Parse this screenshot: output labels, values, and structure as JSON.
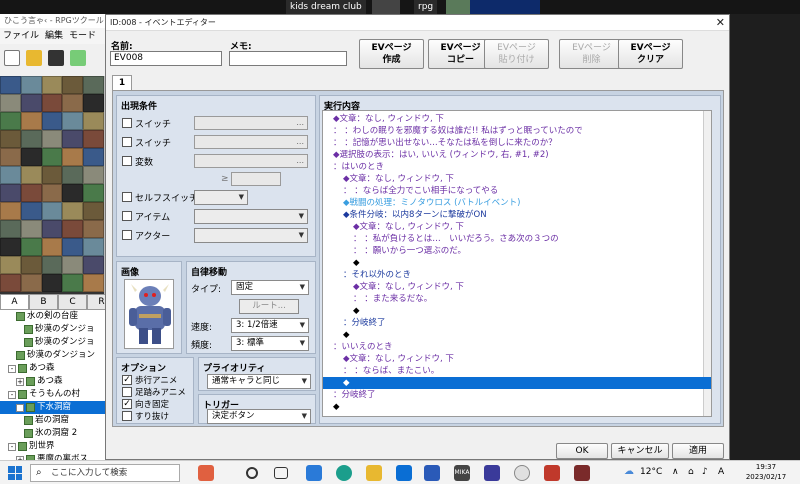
{
  "top_strip": {
    "app1": "kids dream club",
    "app2": "rpg"
  },
  "main_window": {
    "title": "ひこう言ゃ‹ - RPGツクール",
    "menu": [
      "ファイル",
      "編集",
      "モード"
    ],
    "tileset_tabs": [
      "A",
      "B",
      "C",
      "R"
    ],
    "map_tree": [
      {
        "label": "水の剣の台座",
        "indent": 2,
        "exp": ""
      },
      {
        "label": "砂漠のダンジョ",
        "indent": 3,
        "exp": ""
      },
      {
        "label": "砂漠のダンジョ",
        "indent": 3,
        "exp": ""
      },
      {
        "label": "砂漠のダンジョン",
        "indent": 2,
        "exp": ""
      },
      {
        "label": "あつ森",
        "indent": 1,
        "exp": "-"
      },
      {
        "label": "あつ森",
        "indent": 2,
        "exp": "+"
      },
      {
        "label": "そうもんの村",
        "indent": 1,
        "exp": "-"
      },
      {
        "label": "下水洞窟",
        "indent": 2,
        "exp": "-",
        "selected": true
      },
      {
        "label": "岩の洞窟",
        "indent": 3,
        "exp": ""
      },
      {
        "label": "氷の洞窟 2",
        "indent": 3,
        "exp": ""
      },
      {
        "label": "別世界",
        "indent": 1,
        "exp": "-"
      },
      {
        "label": "悪魔の裏ボス",
        "indent": 2,
        "exp": "+"
      }
    ]
  },
  "dialog": {
    "title": "ID:008 - イベントエディター",
    "name_label": "名前:",
    "name_value": "EV008",
    "memo_label": "メモ:",
    "memo_value": "",
    "ev_buttons": [
      {
        "label": "EVページ\n作成",
        "enabled": true
      },
      {
        "label": "EVページ\nコピー",
        "enabled": true
      },
      {
        "label": "EVページ\n貼り付け",
        "enabled": false
      },
      {
        "label": "EVページ\n削除",
        "enabled": false
      },
      {
        "label": "EVページ\nクリア",
        "enabled": true
      }
    ],
    "tab": "1",
    "conditions": {
      "title": "出現条件",
      "switch1": "スイッチ",
      "switch2": "スイッチ",
      "variable": "変数",
      "ge": "≥",
      "self_switch": "セルフスイッチ",
      "item": "アイテム",
      "actor": "アクター",
      "dots": "..."
    },
    "image": {
      "title": "画像"
    },
    "autonomous": {
      "title": "自律移動",
      "type_label": "タイプ:",
      "type_value": "固定",
      "route_button": "ルート...",
      "speed_label": "速度:",
      "speed_value": "3: 1/2倍速",
      "freq_label": "頻度:",
      "freq_value": "3: 標準"
    },
    "options": {
      "title": "オプション",
      "items": [
        {
          "label": "歩行アニメ",
          "checked": true
        },
        {
          "label": "足踏みアニメ",
          "checked": false
        },
        {
          "label": "向き固定",
          "checked": true
        },
        {
          "label": "すり抜け",
          "checked": false
        }
      ]
    },
    "priority": {
      "title": "プライオリティ",
      "value": "通常キャラと同じ"
    },
    "trigger": {
      "title": "トリガー",
      "value": "決定ボタン"
    },
    "contents": {
      "title": "実行内容",
      "lines": [
        {
          "text": "◆文章：なし, ウィンドウ, 下",
          "cls": "c-purple",
          "indent": 10,
          "sel": false
        },
        {
          "text": "：       ：わしの眠りを邪魔する奴は誰だ!! 私はずっと眠っていたので",
          "cls": "c-purple",
          "indent": 10,
          "sel": false
        },
        {
          "text": "：       ：記憶が思い出せない…そなたは私を倒しに来たのか？",
          "cls": "c-purple",
          "indent": 10,
          "sel": false
        },
        {
          "text": "◆選択肢の表示：はい, いいえ (ウィンドウ, 右, #1, #2)",
          "cls": "c-purple",
          "indent": 10,
          "sel": false
        },
        {
          "text": "：はいのとき",
          "cls": "c-purple",
          "indent": 10,
          "sel": false
        },
        {
          "text": "◆文章：なし, ウィンドウ, 下",
          "cls": "c-purple",
          "indent": 20,
          "sel": false
        },
        {
          "text": "：       ：ならば全力でこい相手になってやる",
          "cls": "c-purple",
          "indent": 20,
          "sel": false
        },
        {
          "text": "◆戦闘の処理：ミノタウロス (バトルイベント)",
          "cls": "c-lblue",
          "indent": 20,
          "sel": false
        },
        {
          "text": "◆条件分岐：以内8ターンに撃破がON",
          "cls": "c-blue",
          "indent": 20,
          "sel": false
        },
        {
          "text": "◆文章：なし, ウィンドウ, 下",
          "cls": "c-purple",
          "indent": 30,
          "sel": false
        },
        {
          "text": "：       ：私が負けるとは…　いいだろう。さあ次の３つの",
          "cls": "c-purple",
          "indent": 30,
          "sel": false
        },
        {
          "text": "：       ：願いから一つ選ぶのだ。",
          "cls": "c-purple",
          "indent": 30,
          "sel": false
        },
        {
          "text": "◆",
          "cls": "",
          "indent": 30,
          "sel": false
        },
        {
          "text": "：それ以外のとき",
          "cls": "c-blue",
          "indent": 20,
          "sel": false
        },
        {
          "text": "◆文章：なし, ウィンドウ, 下",
          "cls": "c-purple",
          "indent": 30,
          "sel": false
        },
        {
          "text": "：       ：また来るだな。",
          "cls": "c-purple",
          "indent": 30,
          "sel": false
        },
        {
          "text": "◆",
          "cls": "",
          "indent": 30,
          "sel": false
        },
        {
          "text": "：分岐終了",
          "cls": "c-blue",
          "indent": 20,
          "sel": false
        },
        {
          "text": "◆",
          "cls": "",
          "indent": 20,
          "sel": false
        },
        {
          "text": "：いいえのとき",
          "cls": "c-purple",
          "indent": 10,
          "sel": false
        },
        {
          "text": "◆文章：なし, ウィンドウ, 下",
          "cls": "c-purple",
          "indent": 20,
          "sel": false
        },
        {
          "text": "：       ：ならば、またこい。",
          "cls": "c-purple",
          "indent": 20,
          "sel": false
        },
        {
          "text": "◆",
          "cls": "",
          "indent": 20,
          "sel": true
        },
        {
          "text": "：分岐終了",
          "cls": "c-purple",
          "indent": 10,
          "sel": false
        },
        {
          "text": "◆",
          "cls": "",
          "indent": 10,
          "sel": false
        }
      ]
    },
    "ok": "OK",
    "cancel": "キャンセル",
    "apply": "適用"
  },
  "taskbar": {
    "search_placeholder": "ここに入力して検索",
    "temp": "12°C",
    "ime": "A",
    "time": "19:37",
    "date": "2023/02/17"
  },
  "colors": {
    "selection": "#0a6ed4",
    "panel": "#c7d3e2",
    "group": "#dbe3ee",
    "choice": "#6b2fa5",
    "branch": "#1c3a9e",
    "battle": "#3a9ee0"
  }
}
